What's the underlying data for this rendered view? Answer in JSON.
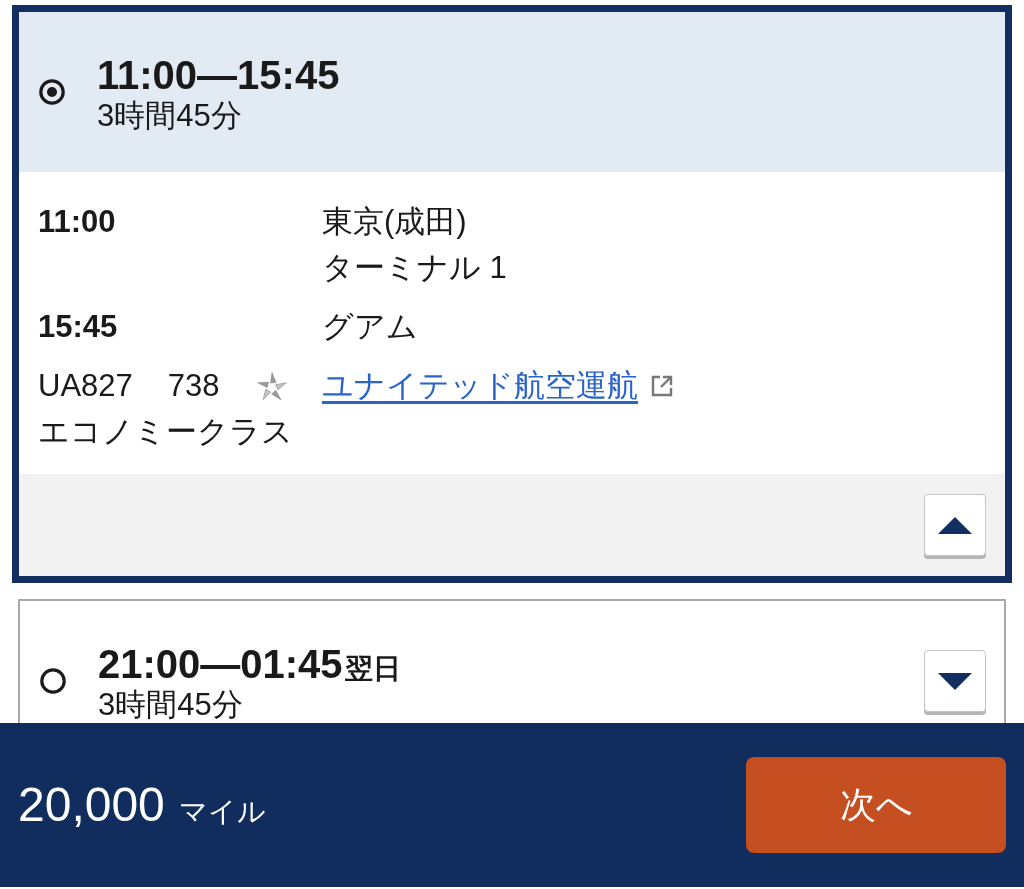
{
  "flights": [
    {
      "selected": true,
      "expanded": true,
      "time_range": "11:00—15:45",
      "duration": "3時間45分",
      "details": {
        "legs": [
          {
            "time": "11:00",
            "place": "東京(成田)",
            "terminal": "ターミナル 1"
          },
          {
            "time": "15:45",
            "place": "グアム"
          }
        ],
        "flight_number": "UA827",
        "aircraft": "738",
        "cabin": "エコノミークラス",
        "operator_link": "ユナイテッド航空運航"
      }
    },
    {
      "selected": false,
      "expanded": false,
      "time_range": "21:00—01:45",
      "day_note": "翌日",
      "duration": "3時間45分"
    }
  ],
  "footer": {
    "miles": "20,000",
    "unit": "マイル",
    "next_button": "次へ"
  }
}
